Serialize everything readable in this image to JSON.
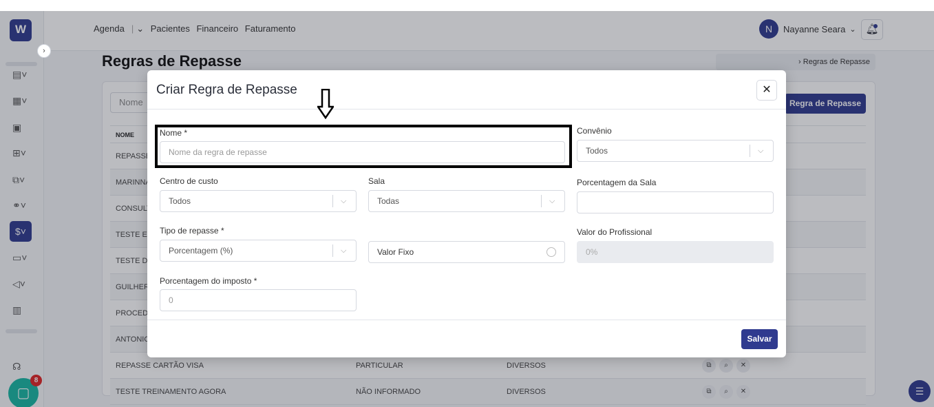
{
  "app": {
    "logo_letter": "W",
    "nav": {
      "agenda": "Agenda",
      "pacientes": "Pacientes",
      "financeiro": "Financeiro",
      "faturamento": "Faturamento"
    },
    "user": {
      "initial": "N",
      "name": "Nayanne Seara"
    },
    "chat_badge": "8",
    "colors": {
      "primary": "#2f3a8f",
      "chat": "#17b6a2",
      "badge": "#e02424"
    }
  },
  "background": {
    "page_title": "Regras de Repasse",
    "breadcrumb_current": "Regras de Repasse",
    "filter_placeholder": "Nome",
    "add_button": "Regra de Repasse",
    "table": {
      "header_nome": "NOME",
      "rows": [
        {
          "nome": "REPASSE",
          "convenio": "",
          "categoria": ""
        },
        {
          "nome": "MARINNA",
          "convenio": "",
          "categoria": ""
        },
        {
          "nome": "CONSULT",
          "convenio": "",
          "categoria": ""
        },
        {
          "nome": "TESTE ER",
          "convenio": "",
          "categoria": ""
        },
        {
          "nome": "TESTE DE",
          "convenio": "",
          "categoria": ""
        },
        {
          "nome": "GUILHERM",
          "convenio": "",
          "categoria": ""
        },
        {
          "nome": "PROCEDI",
          "convenio": "",
          "categoria": ""
        },
        {
          "nome": "ANTONIO",
          "convenio": "",
          "categoria": ""
        },
        {
          "nome": "REPASSE CARTÃO VISA",
          "convenio": "PARTICULAR",
          "categoria": "DIVERSOS"
        },
        {
          "nome": "TESTE TREINAMENTO AGORA",
          "convenio": "NÃO INFORMADO",
          "categoria": "DIVERSOS"
        }
      ]
    }
  },
  "modal": {
    "title": "Criar Regra de Repasse",
    "nome": {
      "label": "Nome *",
      "placeholder": "Nome da regra de repasse"
    },
    "convenio": {
      "label": "Convênio",
      "value": "Todos"
    },
    "centro_custo": {
      "label": "Centro de custo",
      "value": "Todos"
    },
    "sala": {
      "label": "Sala",
      "value": "Todas"
    },
    "porcentagem_sala": {
      "label": "Porcentagem da Sala",
      "value": ""
    },
    "tipo_repasse": {
      "label": "Tipo de repasse *",
      "value": "Porcentagem (%)"
    },
    "valor_fixo": {
      "label": "Valor Fixo"
    },
    "valor_profissional": {
      "label": "Valor do Profissional",
      "placeholder": "0%"
    },
    "porcentagem_imposto": {
      "label": "Porcentagem do imposto *",
      "placeholder": "0"
    },
    "save_label": "Salvar"
  }
}
